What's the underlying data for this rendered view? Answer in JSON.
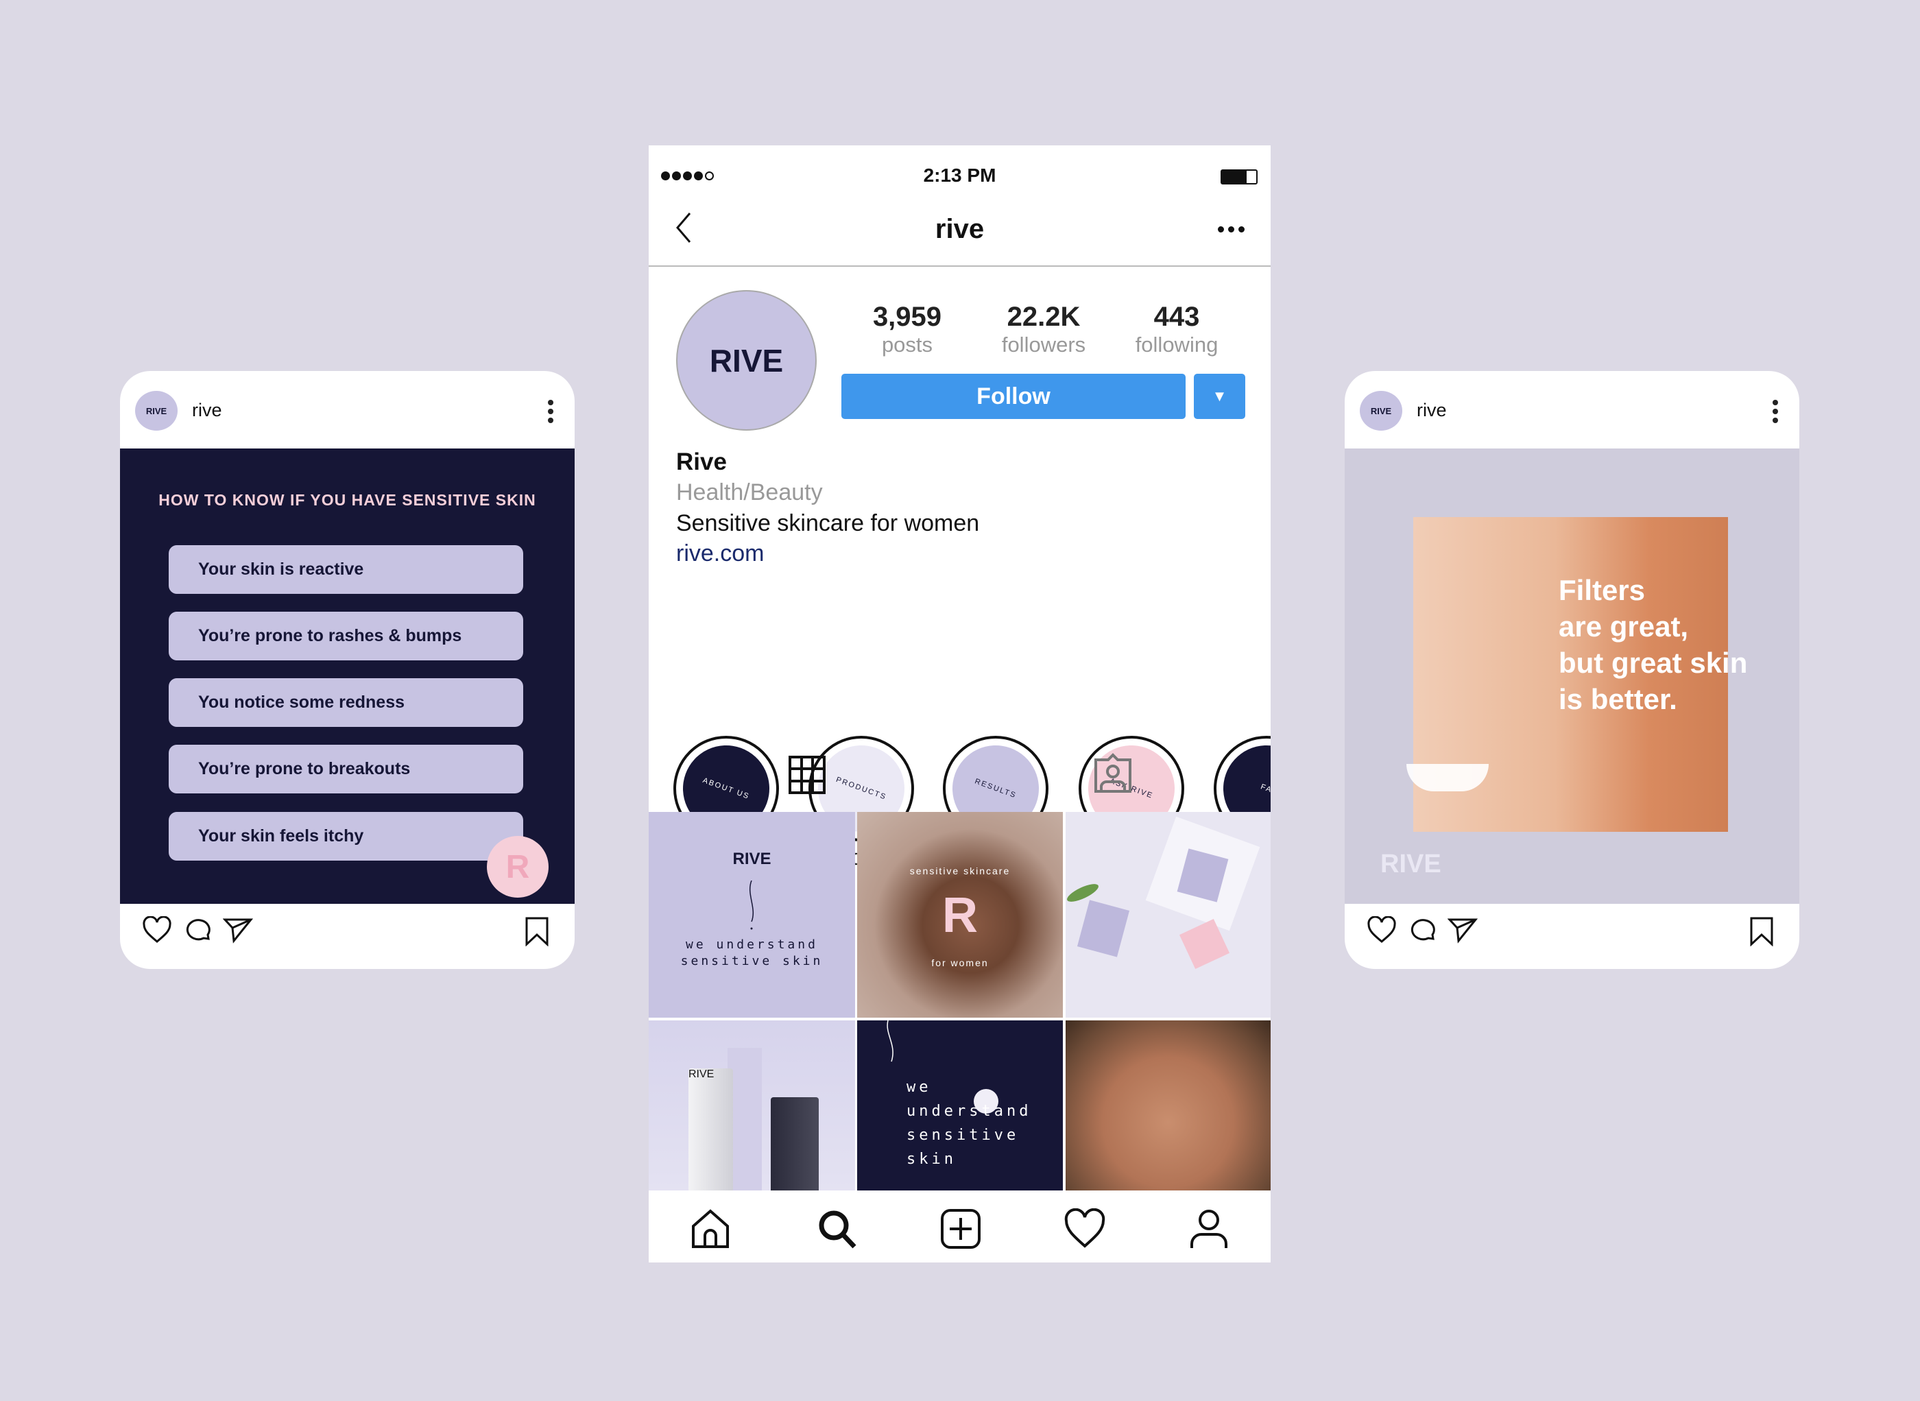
{
  "colors": {
    "background": "#dcd9e5",
    "navy": "#161636",
    "lavender": "#c7c3e2",
    "pink": "#f6cfd9",
    "follow_blue": "#3f97ec",
    "link": "#1a2a6c"
  },
  "left_post": {
    "username": "rive",
    "avatar_text": "RIVE",
    "title": "HOW TO KNOW IF YOU HAVE SENSITIVE SKIN",
    "items": [
      "Your skin is reactive",
      "You’re prone to rashes & bumps",
      "You notice some redness",
      "You’re prone to breakouts",
      "Your skin feels itchy"
    ],
    "badge_text": "R",
    "icons": [
      "heart-icon",
      "comment-icon",
      "share-icon",
      "bookmark-icon"
    ]
  },
  "phone": {
    "status": {
      "time": "2:13 PM",
      "signal_bars": 4,
      "signal_total": 5
    },
    "nav": {
      "title": "rive"
    },
    "profile": {
      "avatar_text": "RIVE",
      "name": "Rive",
      "category": "Health/Beauty",
      "bio": "Sensitive skincare for women",
      "link": "rive.com"
    },
    "stats": [
      {
        "value": "3,959",
        "label": "posts"
      },
      {
        "value": "22.2K",
        "label": "followers"
      },
      {
        "value": "443",
        "label": "following"
      }
    ],
    "follow_label": "Follow",
    "stories": [
      {
        "label": "about us",
        "cover_text": "ABOUT US",
        "color": "#161636",
        "text_color": "#ffffff"
      },
      {
        "label": "products",
        "cover_text": "PRODUCTS",
        "color": "#ebe9f5",
        "text_color": "#161636"
      },
      {
        "label": "results",
        "cover_text": "RESULTS",
        "color": "#c7c3e2",
        "text_color": "#161636"
      },
      {
        "label": "ask rive",
        "cover_text": "ASK RIVE",
        "color": "#f6cfd9",
        "text_color": "#161636"
      },
      {
        "label": "fa",
        "cover_text": "FA",
        "color": "#161636",
        "text_color": "#ffffff"
      }
    ],
    "grid": {
      "tile1": {
        "logo": "RIVE",
        "text1": "we understand",
        "text2": "sensitive skin"
      },
      "tile2": {
        "arc_top": "sensitive skincare",
        "letter": "R",
        "arc_bottom": "for women"
      },
      "tile5": {
        "lines": [
          "we",
          "understand",
          "sensitive",
          "skin"
        ]
      },
      "tile4": {
        "brand": "RIVE"
      }
    },
    "bottom_nav": [
      "home-icon",
      "search-icon",
      "add-icon",
      "heart-icon",
      "profile-icon"
    ]
  },
  "right_post": {
    "username": "rive",
    "avatar_text": "RIVE",
    "headline": [
      "Filters",
      "are great,",
      "but great skin",
      "is better."
    ],
    "watermark": "RIVE"
  }
}
